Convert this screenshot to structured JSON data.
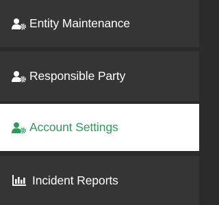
{
  "menu": {
    "items": [
      {
        "label": "Entity Maintenance",
        "icon": "user-gear-icon",
        "active": false
      },
      {
        "label": "Responsible Party",
        "icon": "user-gear-icon",
        "active": false
      },
      {
        "label": "Account Settings",
        "icon": "user-gear-icon",
        "active": true
      },
      {
        "label": "Incident Reports",
        "icon": "bar-chart-icon",
        "active": false
      }
    ]
  },
  "colors": {
    "background": "#2b2b2b",
    "item_background": "#353535",
    "active_background": "#ffffff",
    "active_text": "#2f9a5e",
    "text": "#ffffff"
  }
}
